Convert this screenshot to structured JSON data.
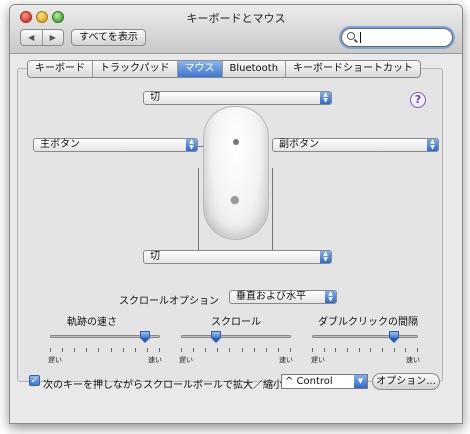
{
  "window": {
    "title": "キーボードとマウス"
  },
  "toolbar": {
    "back": "◀",
    "forward": "▶",
    "show_all": "すべてを表示",
    "search_value": ""
  },
  "tabs": [
    {
      "label": "キーボード",
      "active": false
    },
    {
      "label": "トラックパッド",
      "active": false
    },
    {
      "label": "マウス",
      "active": true
    },
    {
      "label": "Bluetooth",
      "active": false
    },
    {
      "label": "キーボードショートカット",
      "active": false
    }
  ],
  "mouse_buttons": {
    "top": "切",
    "left": "主ボタン",
    "right": "副ボタン",
    "bottom": "切"
  },
  "help": "?",
  "scroll_option": {
    "label": "スクロールオプション",
    "value": "垂直および水平"
  },
  "sliders": [
    {
      "label": "軌跡の速さ",
      "min_label": "遅い",
      "max_label": "速い",
      "level": 0.9
    },
    {
      "label": "スクロール",
      "min_label": "遅い",
      "max_label": "速い",
      "level": 0.3
    },
    {
      "label": "ダブルクリックの間隔",
      "min_label": "遅い",
      "max_label": "速い",
      "level": 0.8
    }
  ],
  "zoom": {
    "label": "次のキーを押しながらスクロールボールで拡大／縮小",
    "checked": true,
    "check_glyph": "✓",
    "key": "^ Control"
  },
  "options_button": "オプション...",
  "colors": {
    "accent": "#3a78d2",
    "window_bg": "#e9e9e9"
  },
  "icons": {
    "apple": "apple-logo-icon",
    "search": "search-icon"
  }
}
